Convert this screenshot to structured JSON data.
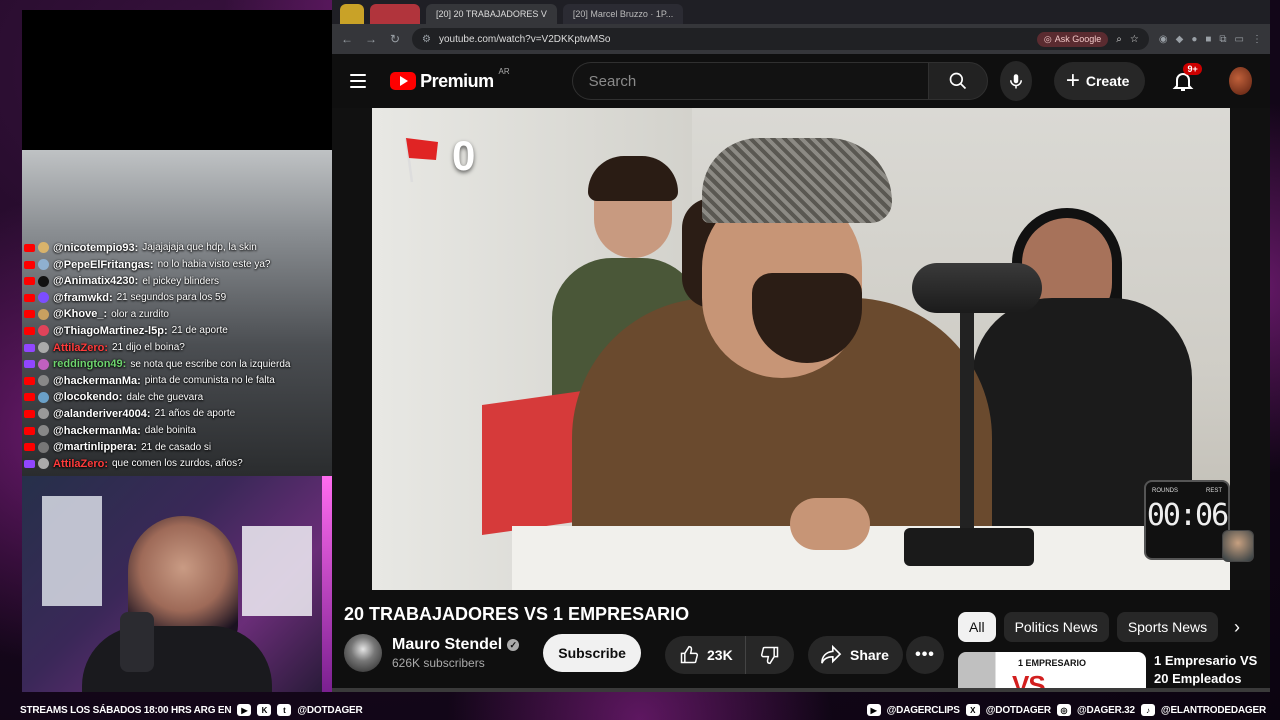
{
  "browser": {
    "tabs": [
      "",
      "",
      "[20] 20 TRABAJADORES V",
      "[20] Marcel Bruzzo · 1P..."
    ],
    "url": "youtube.com/watch?v=V2DKKptwMSo",
    "ask_google": "Ask Google"
  },
  "youtube": {
    "logo_text": "Premium",
    "region": "AR",
    "search_placeholder": "Search",
    "create_label": "Create",
    "notif_badge": "9+"
  },
  "video": {
    "overlay_count": "0",
    "timer_left": "ROUNDS",
    "timer_right": "REST",
    "timer_digits": "00:06"
  },
  "details": {
    "title": "20 TRABAJADORES VS 1 EMPRESARIO",
    "channel_name": "Mauro Stendel",
    "subscribers": "626K subscribers",
    "subscribe_label": "Subscribe",
    "likes": "23K",
    "share_label": "Share",
    "chips": [
      "All",
      "Politics News",
      "Sports News"
    ],
    "recommended": {
      "title": "1 Empresario VS 20 Empleados",
      "thumb_badge": "1 EMPRESARIO",
      "thumb_big": "VS"
    }
  },
  "chat": [
    {
      "platform": "yt",
      "user": "@nicotempio93:",
      "color": "#ffffff",
      "text": "Jajajajaja que hdp, la skin",
      "avatar": "#d9b36b"
    },
    {
      "platform": "yt",
      "user": "@PepeElFritangas:",
      "color": "#ffffff",
      "text": "no lo habia visto este ya?",
      "avatar": "#8fb0d0"
    },
    {
      "platform": "yt",
      "user": "@Animatix4230:",
      "color": "#ffffff",
      "text": "el pickey blinders",
      "avatar": "#111111"
    },
    {
      "platform": "yt",
      "user": "@framwkd:",
      "color": "#ffffff",
      "text": "21 segundos para los 59",
      "avatar": "#7c4dff"
    },
    {
      "platform": "yt",
      "user": "@Khove_:",
      "color": "#ffffff",
      "text": "olor a zurdito",
      "avatar": "#c8a060"
    },
    {
      "platform": "yt",
      "user": "@ThiagoMartinez-l5p:",
      "color": "#ffffff",
      "text": "21 de aporte",
      "avatar": "#e0435a"
    },
    {
      "platform": "tw",
      "user": "AttilaZero:",
      "color": "#ff3b3b",
      "text": "21 dijo el boina?",
      "avatar": "#aaaaaa"
    },
    {
      "platform": "tw",
      "user": "reddington49:",
      "color": "#6dd36d",
      "text": "se nota que escribe con la izquierda",
      "avatar": "#c060c0"
    },
    {
      "platform": "yt",
      "user": "@hackermanMa:",
      "color": "#ffffff",
      "text": "pinta de comunista no le falta",
      "avatar": "#888888"
    },
    {
      "platform": "yt",
      "user": "@locokendo:",
      "color": "#ffffff",
      "text": "dale che guevara",
      "avatar": "#6aa0c8"
    },
    {
      "platform": "yt",
      "user": "@alanderiver4004:",
      "color": "#ffffff",
      "text": "21 años de aporte",
      "avatar": "#999999"
    },
    {
      "platform": "yt",
      "user": "@hackermanMa:",
      "color": "#ffffff",
      "text": "dale boinita",
      "avatar": "#888888"
    },
    {
      "platform": "yt",
      "user": "@martinlippera:",
      "color": "#ffffff",
      "text": "21 de casado si",
      "avatar": "#777777"
    },
    {
      "platform": "tw",
      "user": "AttilaZero:",
      "color": "#ff3b3b",
      "text": "que comen los zurdos, años?",
      "avatar": "#aaaaaa"
    }
  ],
  "banner": {
    "left_text": "STREAMS  LOS SÁBADOS 18:00 HRS ARG EN",
    "left_handle": "@DOTDAGER",
    "right": [
      "@DAGERCLIPS",
      "@DOTDAGER",
      "@DAGER.32",
      "@ELANTRODEDAGER"
    ]
  }
}
